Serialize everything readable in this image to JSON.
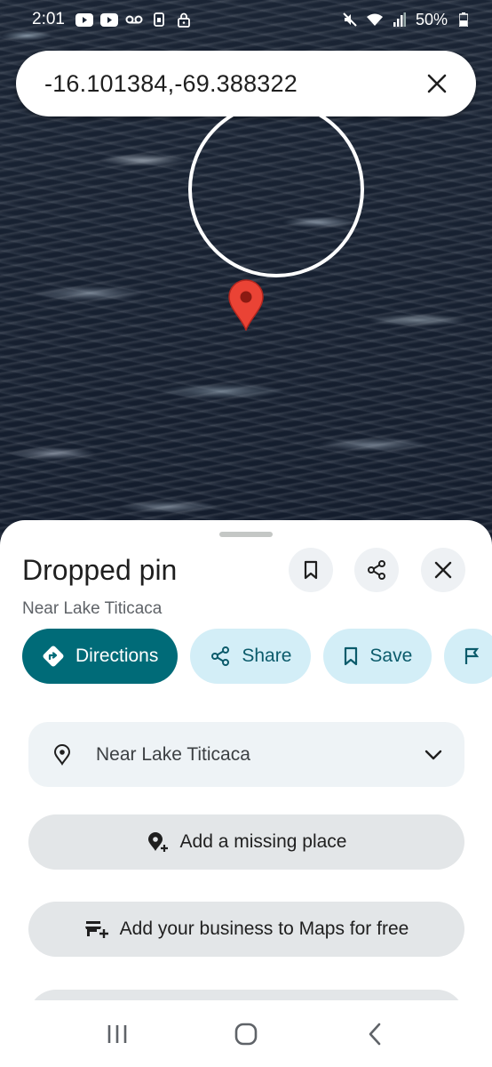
{
  "status_bar": {
    "time": "2:01",
    "battery": "50%",
    "icons": [
      "youtube-icon",
      "youtube-icon",
      "voicemail-icon",
      "sim-icon",
      "lock-icon",
      "mute-icon",
      "wifi-icon",
      "signal-icon",
      "battery-icon"
    ]
  },
  "search": {
    "query": "-16.101384,-69.388322",
    "close_icon": "close-icon"
  },
  "sheet": {
    "title": "Dropped pin",
    "subtitle": "Near Lake Titicaca",
    "actions": [
      {
        "label": "Directions",
        "icon": "directions-icon"
      },
      {
        "label": "Share",
        "icon": "share-icon"
      },
      {
        "label": "Save",
        "icon": "bookmark-icon"
      }
    ],
    "info_row": {
      "text": "Near Lake Titicaca",
      "icon": "location-pin-icon"
    },
    "add_place": "Add a missing place",
    "add_business": "Add your business to Maps for free"
  },
  "colors": {
    "primary": "#006b78",
    "chip_bg": "#d3eef7",
    "chip_text": "#0b5b6b",
    "pin": "#ea4335"
  }
}
